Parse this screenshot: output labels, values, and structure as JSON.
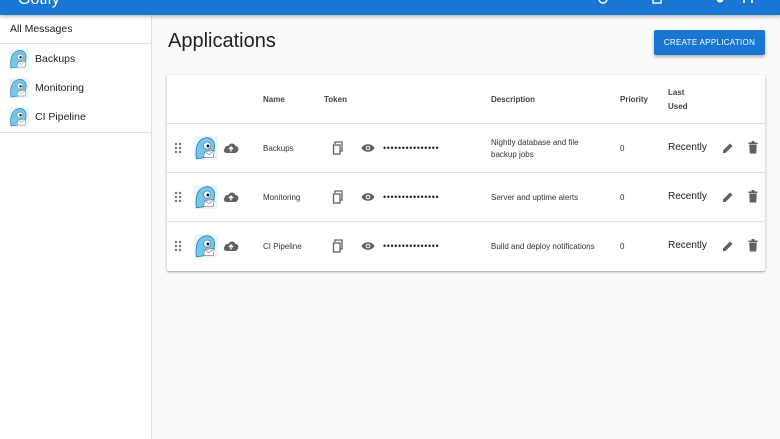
{
  "topbar": {
    "brand": "Gotify"
  },
  "sidebar": {
    "all_label": "All Messages",
    "items": [
      {
        "label": "Backups"
      },
      {
        "label": "Monitoring"
      },
      {
        "label": "CI Pipeline"
      }
    ]
  },
  "main": {
    "title": "Applications",
    "create_label": "CREATE APPLICATION"
  },
  "table": {
    "headers": {
      "name": "Name",
      "token": "Token",
      "description": "Description",
      "priority": "Priority",
      "last_used": "Last Used"
    },
    "rows": [
      {
        "name": "Backups",
        "token": "•••••••••••••••",
        "description": "Nightly database and file backup jobs",
        "priority": "0",
        "last_used": "Recently"
      },
      {
        "name": "Monitoring",
        "token": "•••••••••••••••",
        "description": "Server and uptime alerts",
        "priority": "0",
        "last_used": "Recently"
      },
      {
        "name": "CI Pipeline",
        "token": "•••••••••••••••",
        "description": "Build and deploy notifications",
        "priority": "0",
        "last_used": "Recently"
      }
    ]
  },
  "colors": {
    "primary": "#1976d2",
    "icon_gray": "#616161",
    "avatar_blue": "#73c6ec"
  },
  "icons": [
    "drag-handle-icon",
    "app-avatar-icon",
    "cloud-upload-icon",
    "copy-icon",
    "eye-icon",
    "edit-icon",
    "delete-icon"
  ]
}
